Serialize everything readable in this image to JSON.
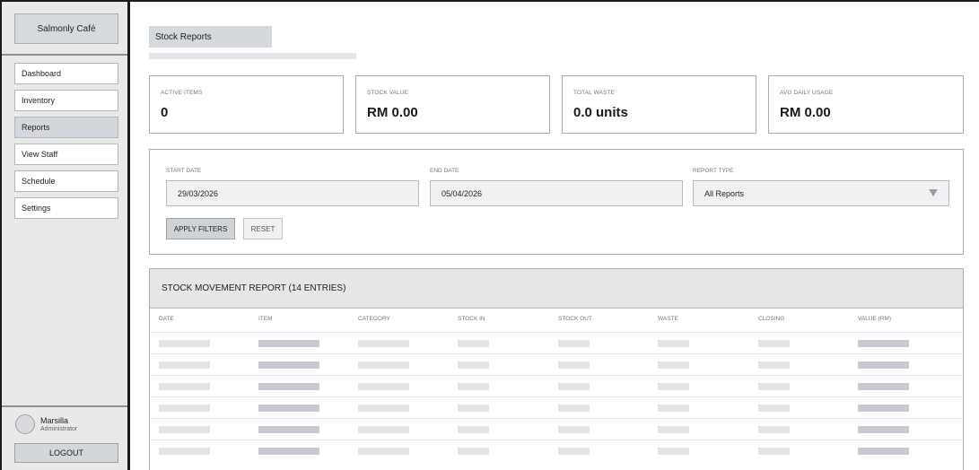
{
  "sidebar": {
    "brand": "Salmonly Café",
    "nav": [
      {
        "label": "Dashboard",
        "active": false
      },
      {
        "label": "Inventory",
        "active": false
      },
      {
        "label": "Reports",
        "active": true
      },
      {
        "label": "View Staff",
        "active": false
      },
      {
        "label": "Schedule",
        "active": false
      },
      {
        "label": "Settings",
        "active": false
      }
    ],
    "user": {
      "name": "Marsilla",
      "role": "Administrator"
    },
    "logout_label": "LOGOUT"
  },
  "main": {
    "title": "Stock Reports",
    "cards": [
      {
        "label": "ACTIVE ITEMS",
        "value": "0"
      },
      {
        "label": "STOCK VALUE",
        "value": "RM 0.00"
      },
      {
        "label": "TOTAL WASTE",
        "value": "0.0 units"
      },
      {
        "label": "AVG DAILY USAGE",
        "value": "RM 0.00"
      }
    ],
    "filters": {
      "start_label": "START DATE",
      "start_value": "29/03/2026",
      "end_label": "END DATE",
      "end_value": "05/04/2026",
      "type_label": "REPORT TYPE",
      "type_value": "All Reports",
      "apply_label": "APPLY FILTERS",
      "reset_label": "RESET"
    },
    "report": {
      "title": "STOCK MOVEMENT REPORT (14 ENTRIES)",
      "columns": [
        "DATE",
        "ITEM",
        "CATEGORY",
        "STOCK IN",
        "STOCK OUT",
        "WASTE",
        "CLOSING",
        "VALUE (RM)"
      ]
    }
  },
  "colors": {
    "sidebar_bg": "#e9e9ea",
    "active_nav": "#d3d6db",
    "placeholder_dark": "#c7cbd1",
    "placeholder_light": "#e1e3e6"
  }
}
